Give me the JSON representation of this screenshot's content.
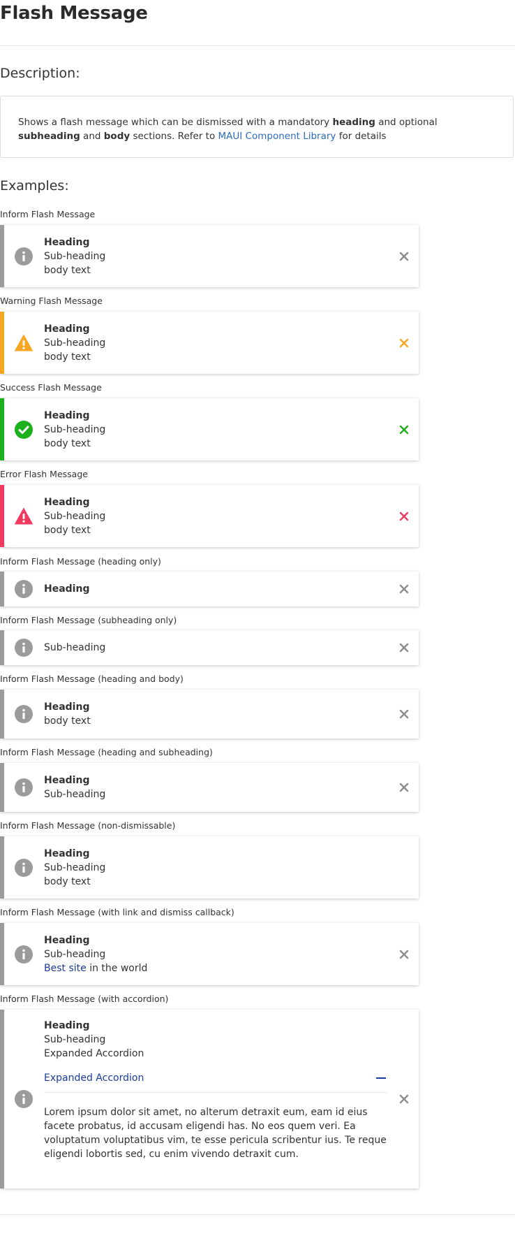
{
  "page": {
    "title": "Flash Message",
    "description_heading": "Description:",
    "examples_heading": "Examples:"
  },
  "description": {
    "text_1": "Shows a flash message which can be dismissed with a mandatory ",
    "bold_1": "heading",
    "text_2": " and optional ",
    "bold_2": "subheading",
    "text_3": " and ",
    "bold_3": "body",
    "text_4": " sections. Refer to ",
    "link": "MAUI Component Library",
    "text_5": " for details"
  },
  "colors": {
    "inform": "#9b9b9b",
    "warning": "#f5a623",
    "success": "#1db01d",
    "error": "#f03a5f",
    "link": "#1a3b9c"
  },
  "examples": [
    {
      "label": "Inform Flash Message",
      "heading": "Heading",
      "subheading": "Sub-heading",
      "body": "body text",
      "icon": "info-icon",
      "variant": "inform"
    },
    {
      "label": "Warning Flash Message",
      "heading": "Heading",
      "subheading": "Sub-heading",
      "body": "body text",
      "icon": "warning-icon",
      "variant": "warning"
    },
    {
      "label": "Success Flash Message",
      "heading": "Heading",
      "subheading": "Sub-heading",
      "body": "body text",
      "icon": "check-circle-icon",
      "variant": "success"
    },
    {
      "label": "Error Flash Message",
      "heading": "Heading",
      "subheading": "Sub-heading",
      "body": "body text",
      "icon": "error-icon",
      "variant": "error"
    },
    {
      "label": "Inform Flash Message (heading only)",
      "heading": "Heading"
    },
    {
      "label": "Inform Flash Message (subheading only)",
      "subheading": "Sub-heading"
    },
    {
      "label": "Inform Flash Message (heading and body)",
      "heading": "Heading",
      "body": "body text"
    },
    {
      "label": "Inform Flash Message (heading and subheading)",
      "heading": "Heading",
      "subheading": "Sub-heading"
    },
    {
      "label": "Inform Flash Message (non-dismissable)",
      "heading": "Heading",
      "subheading": "Sub-heading",
      "body": "body text"
    },
    {
      "label": "Inform Flash Message (with link and dismiss callback)",
      "heading": "Heading",
      "subheading": "Sub-heading",
      "body_link": "Best site",
      "body_rest": " in the world"
    },
    {
      "label": "Inform Flash Message (with accordion)",
      "heading": "Heading",
      "subheading": "Sub-heading",
      "body": "Expanded Accordion",
      "accordion_title": "Expanded Accordion",
      "accordion_body": "Lorem ipsum dolor sit amet, no alterum detraxit eum, eam id eius facete probatus, id accusam eligendi has. No eos quem veri. Ea voluptatum voluptatibus vim, te esse pericula scribentur ius. Te reque eligendi lobortis sed, cu enim vivendo detraxit cum."
    }
  ]
}
